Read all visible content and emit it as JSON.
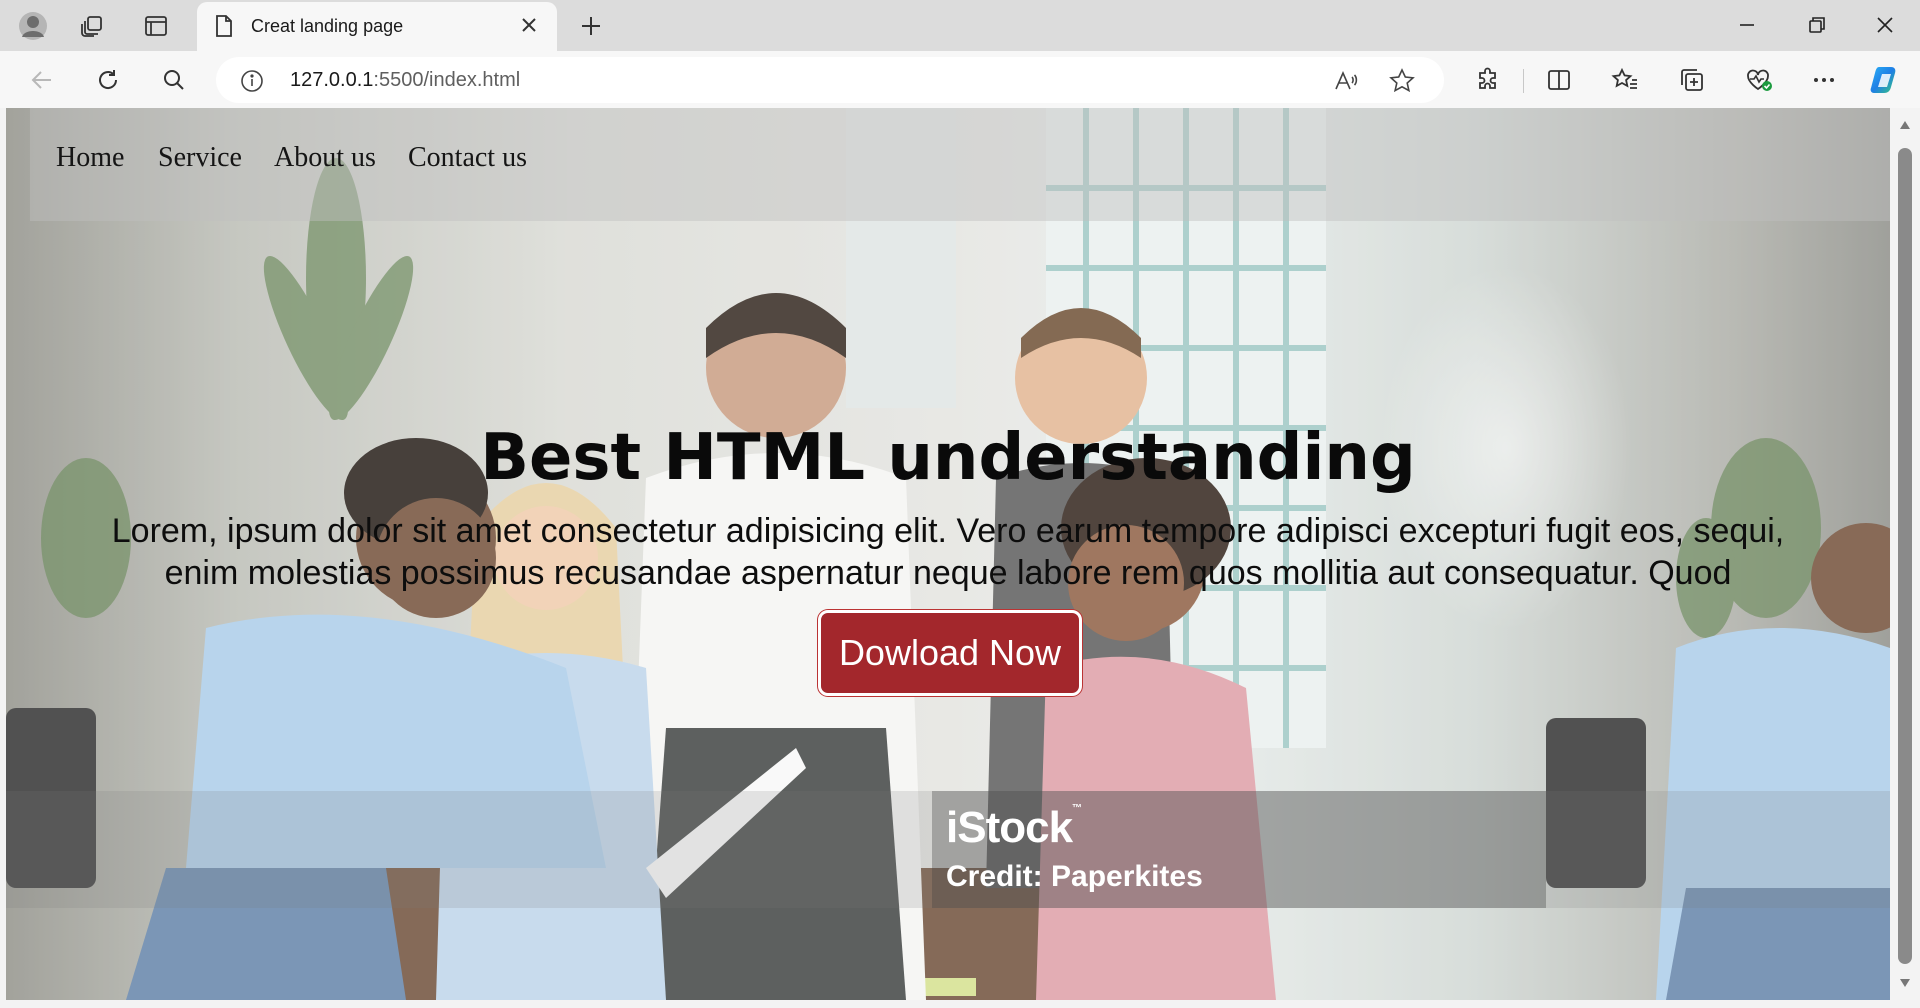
{
  "browser": {
    "tab": {
      "title": "Creat landing page"
    },
    "address": {
      "url_host": "127.0.0.1",
      "url_rest": ":5500/index.html"
    },
    "icons": {
      "profile": "profile-avatar-icon",
      "workspaces": "workspaces-icon",
      "tab_actions": "tab-actions-icon",
      "page": "page-document-icon",
      "close_tab": "close-icon",
      "new_tab": "plus-icon",
      "minimize": "minimize-icon",
      "restore": "restore-icon",
      "close_window": "close-window-icon",
      "back": "back-arrow-icon",
      "refresh": "refresh-icon",
      "search": "search-icon",
      "site_info": "info-icon",
      "read_aloud": "read-aloud-icon",
      "favorite": "star-icon",
      "extensions": "puzzle-icon",
      "split_screen": "split-screen-icon",
      "favorites": "favorites-list-icon",
      "collections": "collections-icon",
      "performance": "heart-pulse-icon",
      "more": "more-dots-icon",
      "copilot": "copilot-icon"
    }
  },
  "page": {
    "nav": {
      "items": [
        {
          "label": "Home"
        },
        {
          "label": "Service"
        },
        {
          "label": "About us"
        },
        {
          "label": "Contact us"
        }
      ]
    },
    "hero": {
      "title": "Best HTML understanding",
      "text_line1": "Lorem, ipsum dolor sit amet consectetur adipisicing elit. Vero earum tempore adipisci excepturi fugit eos, sequi,",
      "text_line2": "enim molestias possimus recusandae aspernatur neque labore rem quos mollitia aut consequatur. Quod",
      "cta_label": "Dowload Now"
    },
    "watermark": {
      "logo": "iStock",
      "tm": "™",
      "credit": "Credit: Paperkites"
    }
  },
  "colors": {
    "cta_background": "#a3272c",
    "copilot_blue": "#1f7fe6"
  }
}
